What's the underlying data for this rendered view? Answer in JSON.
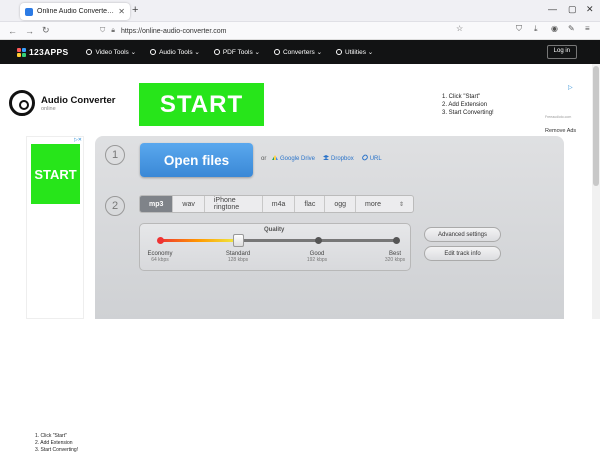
{
  "browser": {
    "tab_title": "Online Audio Converter - Conv",
    "url": "https://online-audio-converter.com"
  },
  "site": {
    "logo": "123APPS",
    "menu": [
      "Video Tools",
      "Audio Tools",
      "PDF Tools",
      "Converters",
      "Utilities"
    ],
    "login": "Log in"
  },
  "brand": {
    "title": "Audio Converter",
    "subtitle": "online"
  },
  "ad_top": {
    "start": "START",
    "steps": [
      "1. Click \"Start\"",
      "2. Add Extension",
      "3. Start Converting!"
    ],
    "site": "Freeaudioto.com",
    "remove_ads": "Remove Ads"
  },
  "ad_side": {
    "start": "START",
    "steps": [
      "1. Click \"Start\"",
      "2. Add Extension",
      "3. Start Converting!"
    ]
  },
  "step1": {
    "number": "1",
    "open_files": "Open files",
    "or": "or",
    "sources": [
      "Google Drive",
      "Dropbox",
      "URL"
    ]
  },
  "step2": {
    "number": "2",
    "formats": [
      "mp3",
      "wav",
      "iPhone ringtone",
      "m4a",
      "flac",
      "ogg",
      "more"
    ],
    "selected_format": "mp3",
    "quality_label": "Quality",
    "quality_levels": [
      {
        "name": "Economy",
        "kbps": "64 kbps"
      },
      {
        "name": "Standard",
        "kbps": "128 kbps"
      },
      {
        "name": "Good",
        "kbps": "192 kbps"
      },
      {
        "name": "Best",
        "kbps": "320 kbps"
      }
    ],
    "selected_quality_index": 1,
    "advanced_settings": "Advanced settings",
    "edit_track_info": "Edit track info"
  },
  "colors": {
    "ad_green": "#27e51a",
    "open_button_blue": "#4a98e2",
    "site_bar": "#121314"
  }
}
